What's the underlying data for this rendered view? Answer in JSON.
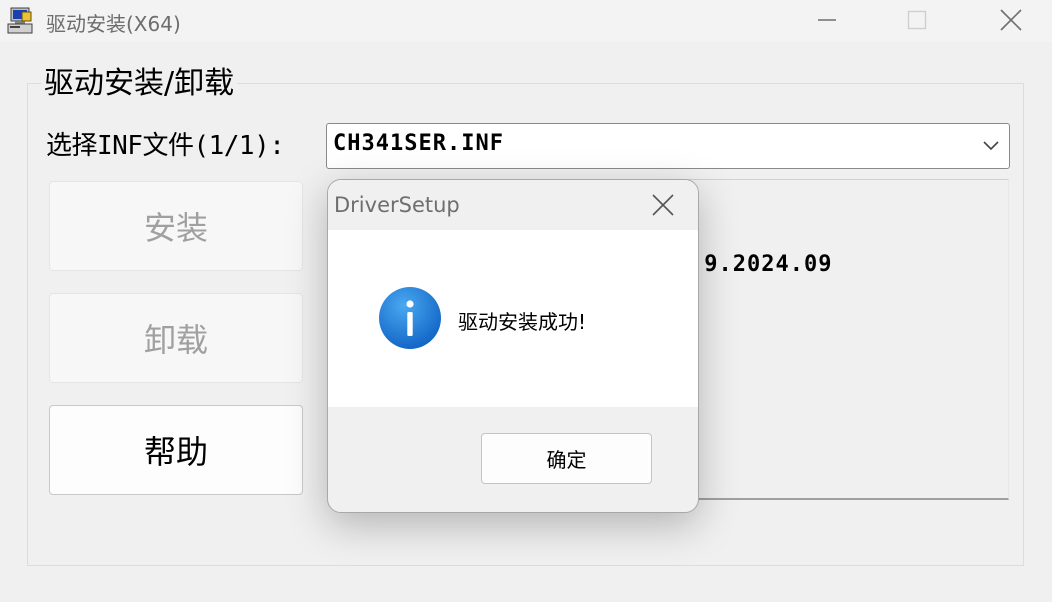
{
  "window": {
    "title": "驱动安装(X64)",
    "icon": "installer-computer-icon",
    "controls": [
      "minimize-icon",
      "maximize-icon",
      "close-icon"
    ]
  },
  "group": {
    "title": "驱动安装/卸载",
    "inf_label": "选择INF文件(1/1):",
    "inf_selected": "CH341SER.INF",
    "buttons": {
      "install": "安装",
      "uninstall": "卸载",
      "help": "帮助"
    },
    "info_text_visible": ".9.2024.09"
  },
  "dialog": {
    "title": "DriverSetup",
    "message": "驱动安装成功!",
    "ok_label": "确定",
    "icon": "info-icon",
    "accent_color": "#1a78d6"
  }
}
